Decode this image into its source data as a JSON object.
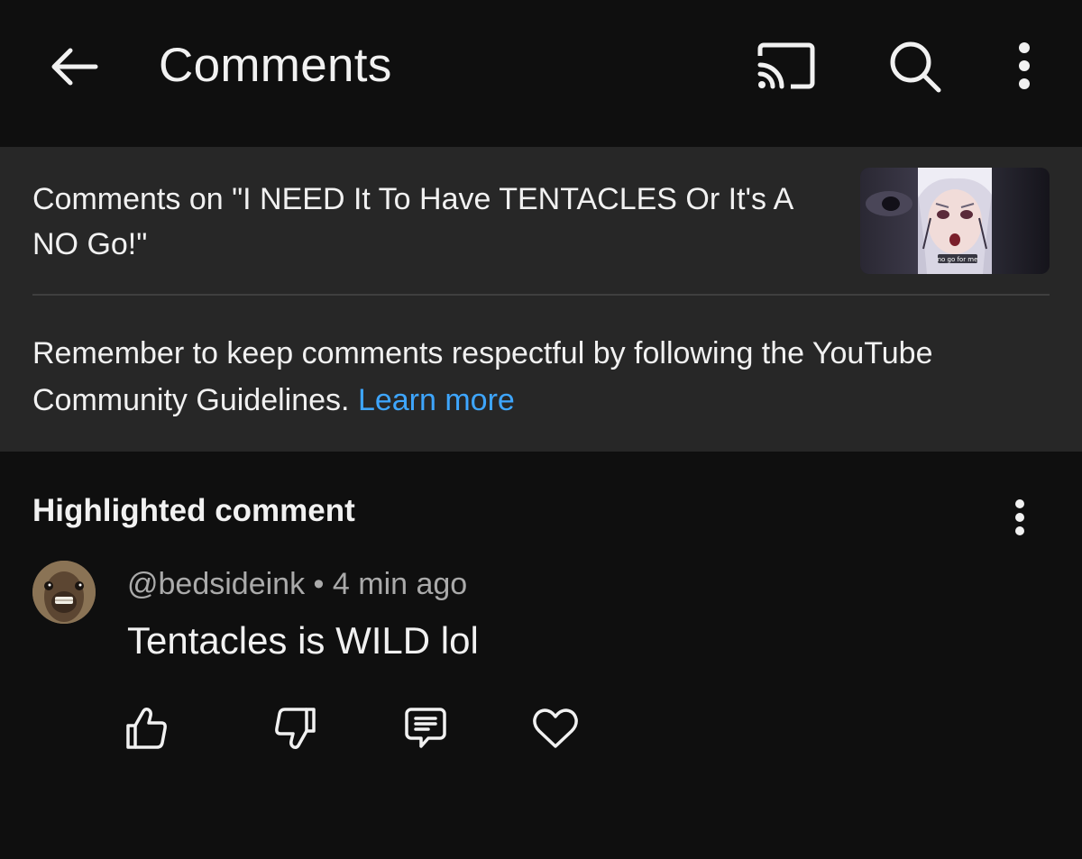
{
  "header": {
    "title": "Comments",
    "back_icon": "arrow-left-icon",
    "cast_icon": "cast-icon",
    "search_icon": "search-icon",
    "more_icon": "more-vertical-icon"
  },
  "video": {
    "comments_title": "Comments on \"I NEED It To Have TENTACLES Or It's A NO Go!\"",
    "thumbnail_caption": "no go for me"
  },
  "guidelines": {
    "text": "Remember to keep comments respectful by following the YouTube Community Guidelines.",
    "link_label": "Learn more"
  },
  "highlighted": {
    "heading": "Highlighted comment",
    "more_icon": "more-vertical-icon",
    "comment": {
      "author": "@bedsideink",
      "separator": "•",
      "time": "4 min ago",
      "text": "Tentacles is WILD lol",
      "actions": [
        "like-icon",
        "dislike-icon",
        "reply-icon",
        "heart-icon"
      ]
    }
  },
  "colors": {
    "background": "#0f0f0f",
    "panel": "#272727",
    "text": "#f1f1f1",
    "secondary_text": "#aaaaaa",
    "link": "#3ea6ff"
  }
}
